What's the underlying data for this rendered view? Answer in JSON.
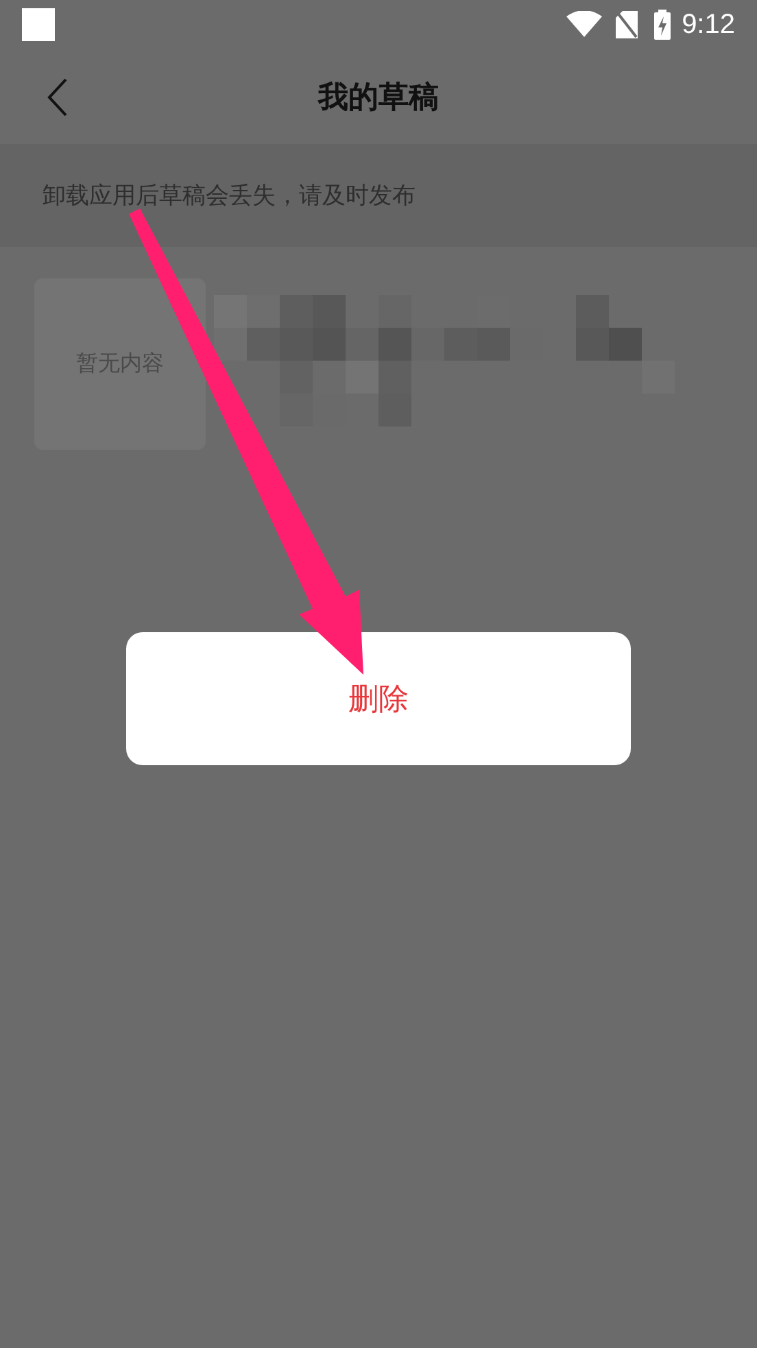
{
  "status_bar": {
    "time": "9:12"
  },
  "header": {
    "title": "我的草稿"
  },
  "notice": "卸载应用后草稿会丢失，请及时发布",
  "drafts": [
    {
      "thumbnail_label": "暂无内容"
    }
  ],
  "dialog": {
    "actions": [
      "删除"
    ]
  }
}
